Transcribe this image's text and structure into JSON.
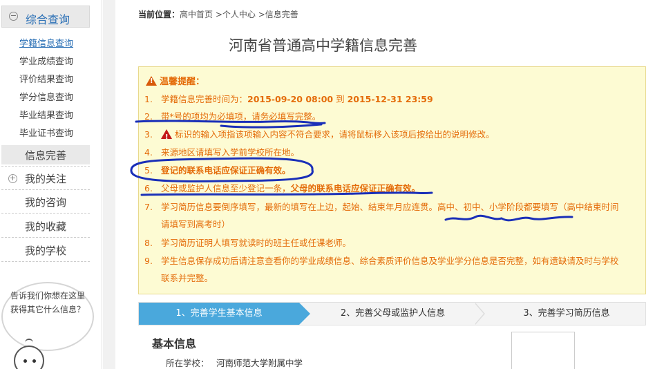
{
  "sidebar": {
    "section_title": "综合查询",
    "sub_items": [
      "学籍信息查询",
      "学业成绩查询",
      "评价结果查询",
      "学分信息查询",
      "毕业结果查询",
      "毕业证书查询"
    ],
    "info_complete": "信息完善",
    "my_follow": "我的关注",
    "links": [
      "我的咨询",
      "我的收藏",
      "我的学校"
    ],
    "bubble": "告诉我们你想在这里获得其它什么信息？"
  },
  "breadcrumb": {
    "label": "当前位置：",
    "path": "高中首页 >个人中心 >信息完善"
  },
  "page_title": "河南省普通高中学籍信息完善",
  "notice": {
    "heading": "温馨提醒：",
    "item1_num": "1.",
    "item1_prefix": "学籍信息完善时间为：",
    "item1_start": "2015-09-20 08:00",
    "item1_to": " 到 ",
    "item1_end": "2015-12-31 23:59",
    "item2_num": "2.",
    "item2": "带*号的项均为必填项，请务必填写完整。",
    "item3_num": "3.",
    "item3": "标识的输入项指该项输入内容不符合要求，请将鼠标移入该项后按给出的说明修改。",
    "item4_num": "4.",
    "item4": "来源地区请填写入学前学校所在地。",
    "item5_num": "5.",
    "item5": "登记的联系电话应保证正确有效。",
    "item6_num": "6.",
    "item6_a": "父母或监护人信息至少登记一条，",
    "item6_b": "父母的联系电话应保证正确有效。",
    "item7_num": "7.",
    "item7_line1": "学习简历信息要倒序填写，最新的填写在上边，起始、结束年月应连贯。高中、初中、小学阶段都要填写（高中结束时间",
    "item7_line2": "请填写到高考时）",
    "item8_num": "8.",
    "item8": "学习简历证明人填写就读时的班主任或任课老师。",
    "item9_num": "9.",
    "item9_line1": "学生信息保存成功后请注意查看你的学业成绩信息、综合素质评价信息及学业学分信息是否完整，如有遗缺请及时与学校",
    "item9_line2": "联系并完整。"
  },
  "steps": [
    "1、完善学生基本信息",
    "2、完善父母或监护人信息",
    "3、完善学习简历信息"
  ],
  "basic": {
    "title": "基本信息",
    "school_label": "所在学校：",
    "school_value": "河南师范大学附属中学"
  },
  "colors": {
    "accent_blue": "#4aa8dc",
    "notice_text": "#e46c0a",
    "notice_bg": "#fdfbd3",
    "annotation_ink": "#1a2fb8"
  }
}
